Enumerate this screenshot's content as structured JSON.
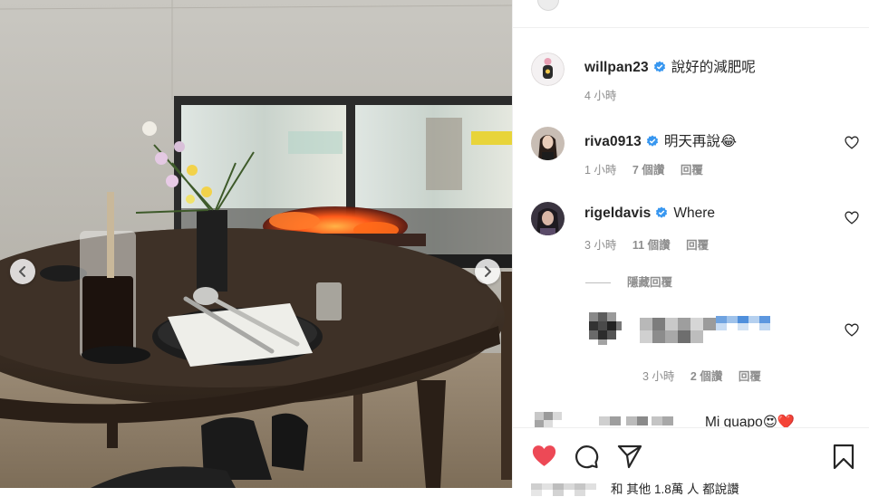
{
  "post": {
    "photo_alt": "",
    "nav": {
      "prev": "previous-photo",
      "next": "next-photo"
    }
  },
  "caption": {
    "username": "willpan23",
    "text": "說好的減肥呢",
    "time": "4 小時"
  },
  "comments": [
    {
      "username": "riva0913",
      "text": "明天再說😂",
      "time": "1 小時",
      "likes": "7 個讚",
      "reply": "回覆"
    },
    {
      "username": "rigeldavis",
      "text": "Where",
      "time": "3 小時",
      "likes": "11 個讚",
      "reply": "回覆"
    }
  ],
  "hidden_replies_label": "隱藏回覆",
  "blurred_reply": {
    "time": "3 小時",
    "likes": "2 個讚",
    "reply": "回覆"
  },
  "partial_comment": {
    "text": "Mi guapo😍❤️"
  },
  "likes_line": "和 其他 1.8萬 人 都說讚",
  "colors": {
    "heart": "#ed4956",
    "verified": "#3897f0",
    "meta": "#8e8e8e"
  },
  "icons": [
    "chevron-left-icon",
    "chevron-right-icon",
    "verified-badge-icon",
    "heart-outline-icon",
    "heart-filled-icon",
    "comment-icon",
    "share-icon",
    "bookmark-icon"
  ]
}
